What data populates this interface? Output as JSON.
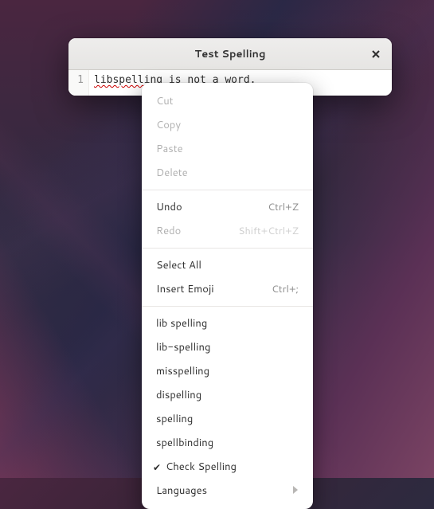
{
  "window": {
    "title": "Test Spelling"
  },
  "editor": {
    "line_number": "1",
    "misspelled_word": "libspelling",
    "rest_of_line": " is not a word."
  },
  "menu": {
    "cut": "Cut",
    "copy": "Copy",
    "paste": "Paste",
    "delete": "Delete",
    "undo": {
      "label": "Undo",
      "accel": "Ctrl+Z"
    },
    "redo": {
      "label": "Redo",
      "accel": "Shift+Ctrl+Z"
    },
    "select_all": "Select All",
    "insert_emoji": {
      "label": "Insert Emoji",
      "accel": "Ctrl+;"
    },
    "suggestions": [
      "lib spelling",
      "lib-spelling",
      "misspelling",
      "dispelling",
      "spelling",
      "spellbinding"
    ],
    "check_spelling": "Check Spelling",
    "languages": "Languages"
  }
}
